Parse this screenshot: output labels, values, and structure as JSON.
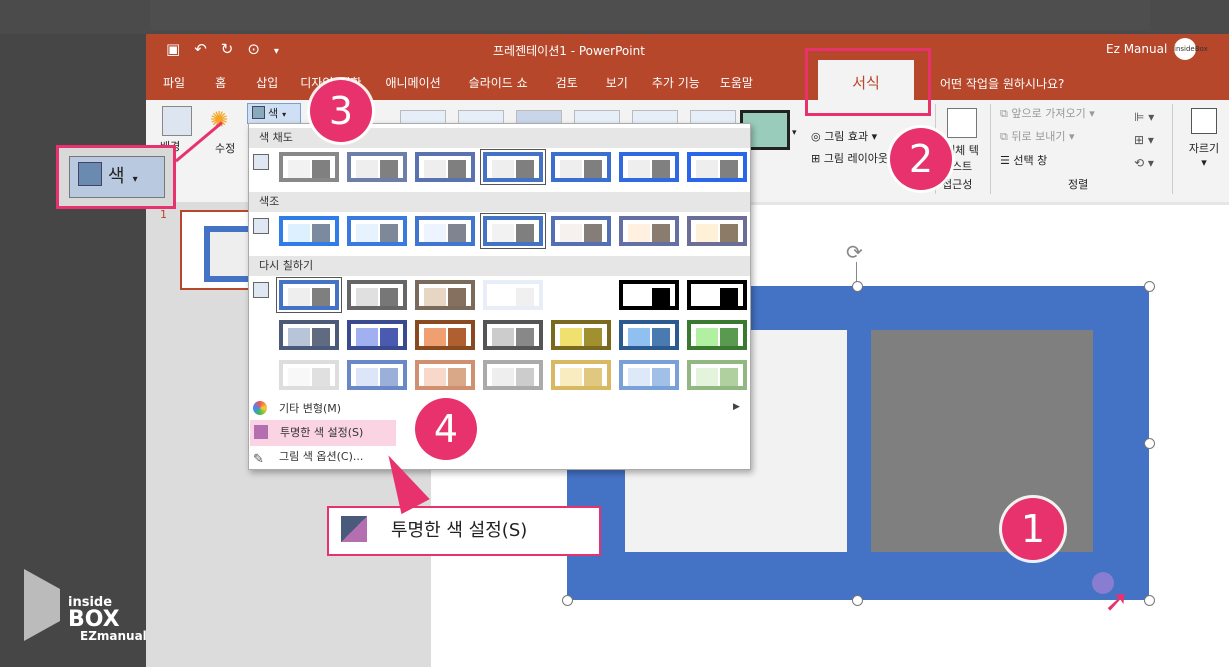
{
  "window": {
    "title": "프레젠테이션1 - PowerPoint",
    "user": "Ez Manual",
    "avatar_text": "insideBox"
  },
  "tabs": [
    "파일",
    "홈",
    "삽입",
    "디자인",
    "전환",
    "애니메이션",
    "슬라이드 쇼",
    "검토",
    "보기",
    "추가 기능",
    "도움말"
  ],
  "active_tab": "서식",
  "tell_me": "어떤 작업을 원하시나요?",
  "ribbon": {
    "background_label": "배경",
    "corrections_label": "수정",
    "color_label": "색",
    "picture_effects": "그림 효과",
    "picture_layout": "그림 레이아웃",
    "alt_text": "대체 텍스트",
    "accessibility": "접근성",
    "bring_forward": "앞으로 가져오기",
    "send_backward": "뒤로 보내기",
    "selection_pane": "선택 창",
    "arrange_group": "정렬",
    "crop": "자르기"
  },
  "dropdown": {
    "saturation_title": "색 채도",
    "tone_title": "색조",
    "recolor_title": "다시 칠하기",
    "more_variations": "기타 변형(M)",
    "set_transparent": "투명한 색 설정(S)",
    "color_options": "그림 색 옵션(C)..."
  },
  "slide_panel": {
    "number": "1"
  },
  "annotations": {
    "badge1": "1",
    "badge2": "2",
    "badge3": "3",
    "badge4": "4",
    "zoom_color_label": "색",
    "callout_label": "투명한 색 설정(S)"
  },
  "logo": {
    "line1": "inside",
    "line2": "BOX",
    "line3": "EZmanual"
  },
  "colors": {
    "accent": "#b7472a",
    "highlight": "#e8326d",
    "picture_blue": "#4472c4",
    "picture_gray": "#7f7f7f"
  }
}
